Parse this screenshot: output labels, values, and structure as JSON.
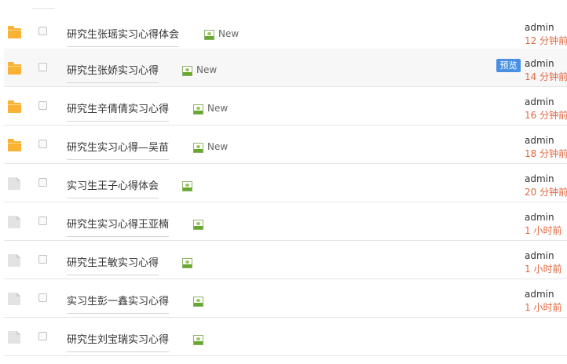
{
  "rows": [
    {
      "icon": "folder-icon",
      "title": "研究生张瑶实习心得体会",
      "badge": "New",
      "author": "admin",
      "time": "12 分钟前"
    },
    {
      "icon": "folder-icon",
      "title": "研究生张娇实习心得",
      "badge": "New",
      "preview_label": "预览",
      "author": "admin",
      "time": "14 分钟前"
    },
    {
      "icon": "folder-icon",
      "title": "研究生辛倩倩实习心得",
      "badge": "New",
      "author": "admin",
      "time": "16 分钟前"
    },
    {
      "icon": "folder-icon",
      "title": "研究生实习心得—吴苗",
      "badge": "New",
      "author": "admin",
      "time": "18 分钟前"
    },
    {
      "icon": "file-icon",
      "title": "实习生王子心得体会",
      "author": "admin",
      "time": "20 分钟前"
    },
    {
      "icon": "file-icon",
      "title": "研究生实习心得王亚楠",
      "author": "admin",
      "time": "1 小时前"
    },
    {
      "icon": "file-icon",
      "title": "研究生王敏实习心得",
      "author": "admin",
      "time": "1 小时前"
    },
    {
      "icon": "file-icon",
      "title": "实习生彭一鑫实习心得",
      "author": "admin",
      "time": "1 小时前"
    },
    {
      "icon": "file-icon",
      "title": "研究生刘宝瑞实习心得"
    }
  ]
}
